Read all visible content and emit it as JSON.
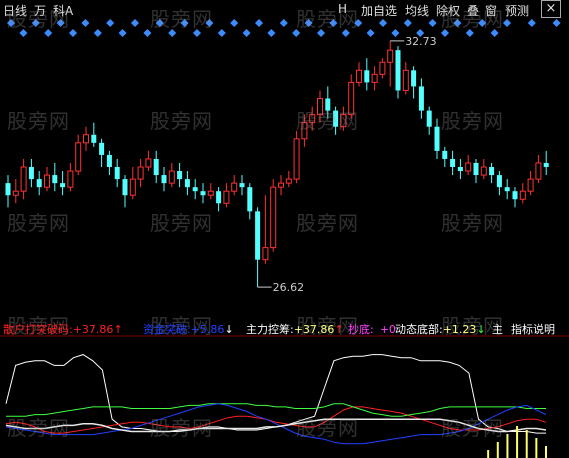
{
  "toolbar": {
    "left": [
      "日线",
      "万",
      "科A"
    ],
    "right": [
      "H",
      "加自选",
      "均线",
      "除权",
      "叠",
      "窗",
      "预测"
    ],
    "close_label": "×"
  },
  "watermark": "股旁网",
  "colors": {
    "up": "#ff3232",
    "down": "#54ffff",
    "diamond": "#3c8cff",
    "main_force": "#ffffff",
    "retail": "#ff2020",
    "green_line": "#40ff40",
    "blue_line": "#2040ff",
    "volume_bar": "#ffff66"
  },
  "price_labels": {
    "high": "32.73",
    "low": "26.62"
  },
  "indicator": {
    "items": [
      {
        "label": "散户打突破码:",
        "value": "+37.86",
        "arrow": "↑",
        "color": "#ff2020"
      },
      {
        "label": "资金突破:",
        "value": "+5.86",
        "arrow": "↓",
        "color": "#2040ff"
      },
      {
        "label": "主力控筹:",
        "value": "+37.86",
        "arrow": "↑",
        "color": "#ffffff"
      },
      {
        "label": "抄底:",
        "value": "+0",
        "arrow": "",
        "color": "#ff40ff"
      },
      {
        "label": "动态底部:",
        "value": "+1.23",
        "arrow": "↓",
        "color": "#ffffff"
      },
      {
        "label": "主",
        "value": "",
        "arrow": "",
        "color": "#ffffff"
      }
    ],
    "help_label": "指标说明"
  },
  "chart_data": [
    {
      "type": "candlestick",
      "title": "",
      "high_label": 32.73,
      "low_label": 26.62,
      "candles": [
        [
          29.2,
          28.9,
          29.4,
          28.6
        ],
        [
          28.9,
          29.0,
          29.3,
          28.7
        ],
        [
          29.0,
          29.6,
          29.8,
          28.8
        ],
        [
          29.6,
          29.3,
          29.8,
          29.1
        ],
        [
          29.3,
          29.1,
          29.5,
          28.9
        ],
        [
          29.1,
          29.4,
          29.6,
          29.0
        ],
        [
          29.4,
          29.2,
          29.7,
          29.0
        ],
        [
          29.2,
          29.1,
          29.5,
          28.9
        ],
        [
          29.1,
          29.5,
          29.7,
          29.0
        ],
        [
          29.5,
          30.2,
          30.4,
          29.4
        ],
        [
          30.2,
          30.4,
          30.6,
          30.0
        ],
        [
          30.4,
          30.2,
          30.7,
          30.1
        ],
        [
          30.2,
          29.9,
          30.3,
          29.6
        ],
        [
          29.9,
          29.6,
          30.0,
          29.4
        ],
        [
          29.6,
          29.3,
          29.8,
          29.1
        ],
        [
          29.3,
          28.9,
          29.4,
          28.6
        ],
        [
          28.9,
          29.3,
          29.6,
          28.8
        ],
        [
          29.3,
          29.6,
          29.8,
          29.1
        ],
        [
          29.6,
          29.8,
          30.0,
          29.5
        ],
        [
          29.8,
          29.4,
          30.0,
          29.2
        ],
        [
          29.4,
          29.2,
          29.6,
          29.0
        ],
        [
          29.2,
          29.5,
          29.7,
          29.1
        ],
        [
          29.5,
          29.3,
          29.7,
          29.1
        ],
        [
          29.3,
          29.1,
          29.5,
          28.9
        ],
        [
          29.1,
          29.0,
          29.3,
          28.8
        ],
        [
          29.0,
          28.9,
          29.2,
          28.7
        ],
        [
          28.9,
          29.0,
          29.2,
          28.8
        ],
        [
          29.0,
          28.7,
          29.1,
          28.5
        ],
        [
          28.7,
          29.0,
          29.2,
          28.6
        ],
        [
          29.0,
          29.2,
          29.4,
          28.9
        ],
        [
          29.2,
          29.1,
          29.4,
          28.9
        ],
        [
          29.1,
          28.5,
          29.2,
          28.3
        ],
        [
          28.5,
          27.3,
          28.6,
          26.62
        ],
        [
          27.3,
          27.6,
          28.9,
          27.2
        ],
        [
          27.6,
          29.1,
          29.3,
          27.5
        ],
        [
          29.1,
          29.2,
          29.4,
          28.9
        ],
        [
          29.2,
          29.3,
          29.5,
          29.1
        ],
        [
          29.3,
          30.3,
          30.5,
          29.2
        ],
        [
          30.3,
          30.7,
          30.9,
          30.1
        ],
        [
          30.7,
          30.9,
          31.1,
          30.5
        ],
        [
          30.9,
          31.3,
          31.5,
          30.7
        ],
        [
          31.3,
          31.0,
          31.6,
          30.8
        ],
        [
          31.0,
          30.6,
          31.1,
          30.4
        ],
        [
          30.6,
          30.9,
          31.1,
          30.5
        ],
        [
          30.9,
          31.7,
          31.9,
          30.8
        ],
        [
          31.7,
          32.0,
          32.2,
          31.6
        ],
        [
          32.0,
          31.7,
          32.3,
          31.5
        ],
        [
          31.7,
          31.9,
          32.1,
          31.5
        ],
        [
          31.9,
          32.2,
          32.3,
          31.8
        ],
        [
          32.2,
          32.5,
          32.73,
          31.6
        ],
        [
          32.5,
          31.5,
          32.6,
          31.3
        ],
        [
          31.5,
          32.0,
          32.2,
          31.4
        ],
        [
          32.0,
          31.6,
          32.1,
          31.3
        ],
        [
          31.6,
          31.0,
          31.8,
          30.8
        ],
        [
          31.0,
          30.6,
          31.1,
          30.4
        ],
        [
          30.6,
          30.0,
          30.8,
          29.8
        ],
        [
          30.0,
          29.8,
          30.1,
          29.6
        ],
        [
          29.8,
          29.6,
          30.0,
          29.4
        ],
        [
          29.6,
          29.5,
          29.8,
          29.3
        ],
        [
          29.5,
          29.7,
          29.9,
          29.4
        ],
        [
          29.7,
          29.4,
          29.8,
          29.2
        ],
        [
          29.4,
          29.6,
          29.8,
          29.3
        ],
        [
          29.6,
          29.4,
          29.7,
          29.2
        ],
        [
          29.4,
          29.1,
          29.5,
          28.9
        ],
        [
          29.1,
          29.0,
          29.3,
          28.8
        ],
        [
          29.0,
          28.8,
          29.1,
          28.6
        ],
        [
          28.8,
          29.0,
          29.2,
          28.7
        ],
        [
          29.0,
          29.3,
          29.5,
          28.9
        ],
        [
          29.3,
          29.7,
          29.9,
          29.2
        ],
        [
          29.7,
          29.6,
          30.0,
          29.4
        ]
      ]
    },
    {
      "type": "line",
      "title": "",
      "series": [
        {
          "name": "主力控筹",
          "values": [
            30,
            55,
            57,
            58,
            58,
            55,
            55,
            60,
            62,
            58,
            52,
            20,
            15,
            14,
            14,
            13,
            12,
            12,
            12,
            13,
            14,
            15,
            15,
            14,
            13,
            13,
            13,
            14,
            15,
            16,
            18,
            20,
            22,
            40,
            58,
            60,
            61,
            61,
            62,
            62,
            61,
            60,
            60,
            58,
            58,
            58,
            57,
            55,
            50,
            20,
            15,
            14,
            12,
            12,
            12,
            11,
            11
          ]
        },
        {
          "name": "散户打突破码",
          "values": [
            17,
            18,
            17,
            15,
            12,
            11,
            11,
            12,
            13,
            14,
            15,
            16,
            17,
            18,
            18,
            17,
            16,
            15,
            15,
            14,
            15,
            17,
            19,
            21,
            22,
            22,
            21,
            20,
            18,
            17,
            16,
            15,
            15,
            18,
            22,
            26,
            28,
            28,
            27,
            26,
            25,
            24,
            22,
            20,
            18,
            16,
            14,
            13,
            13,
            13,
            14,
            15,
            17,
            19,
            20,
            20,
            18
          ]
        },
        {
          "name": "资金突破",
          "values": [
            22,
            22,
            22,
            23,
            23,
            24,
            25,
            26,
            27,
            28,
            28,
            28,
            28,
            27,
            27,
            27,
            27,
            27,
            28,
            29,
            29,
            30,
            30,
            30,
            30,
            30,
            29,
            29,
            28,
            28,
            27,
            27,
            27,
            28,
            30,
            30,
            28,
            26,
            24,
            23,
            22,
            22,
            23,
            24,
            25,
            27,
            28,
            28,
            28,
            28,
            28,
            28,
            28,
            28,
            27,
            27,
            27
          ]
        },
        {
          "name": "",
          "values": [
            15,
            14,
            13,
            12,
            11,
            10,
            10,
            10,
            10,
            10,
            11,
            12,
            13,
            14,
            16,
            18,
            20,
            22,
            24,
            26,
            28,
            29,
            30,
            29,
            27,
            25,
            22,
            20,
            17,
            14,
            11,
            9,
            8,
            7,
            5,
            4,
            4,
            4,
            5,
            6,
            7,
            8,
            9,
            10,
            10,
            10,
            11,
            12,
            14,
            17,
            20,
            23,
            26,
            28,
            29,
            26,
            23
          ]
        },
        {
          "name": "",
          "values": [
            16,
            15,
            14,
            14,
            14,
            15,
            16,
            16,
            17,
            17,
            16,
            14,
            13,
            12,
            12,
            12,
            12,
            12,
            13,
            13,
            14,
            14,
            14,
            14,
            14,
            14,
            14,
            15,
            15,
            16,
            17,
            18,
            19,
            20,
            20,
            20,
            20,
            20,
            20,
            20,
            20,
            20,
            20,
            20,
            20,
            20,
            19,
            18,
            16,
            14,
            13,
            12,
            12,
            13,
            14,
            14,
            13
          ]
        }
      ],
      "volume_bars": [
        0,
        0,
        0,
        0,
        0,
        0,
        0,
        0,
        0,
        0,
        0,
        0,
        0,
        0,
        0,
        0,
        0,
        0,
        0,
        0,
        0,
        0,
        0,
        0,
        0,
        0,
        0,
        0,
        0,
        0,
        0,
        0,
        0,
        0,
        0,
        0,
        0,
        0,
        0,
        0,
        0,
        0,
        0,
        0,
        0,
        0,
        0,
        0,
        0,
        0,
        4,
        8,
        12,
        16,
        14,
        10,
        6
      ]
    }
  ]
}
